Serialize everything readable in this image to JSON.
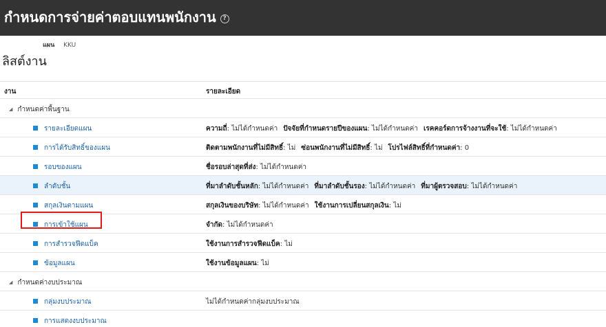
{
  "header": {
    "title": "กำหนดการจ่ายค่าตอบแทนพนักงาน",
    "help_icon": "help-circle-icon"
  },
  "plan": {
    "label": "แผน",
    "value": "KKU"
  },
  "page": {
    "heading": "ลิสต์งาน"
  },
  "table": {
    "col_task": "งาน",
    "col_detail": "รายละเอียด"
  },
  "rows": [
    {
      "type": "group",
      "label": "กำหนดค่าพื้นฐาน"
    },
    {
      "type": "task",
      "label": "รายละเอียดแผน",
      "details": [
        {
          "k": "ความถี่",
          "v": "ไม่ได้กำหนดค่า"
        },
        {
          "k": "ปัจจัยที่กำหนดรายปีของแผน",
          "v": "ไม่ได้กำหนดค่า"
        },
        {
          "k": "เรคคอร์ดการจ้างงานที่จะใช้",
          "v": "ไม่ได้กำหนดค่า"
        }
      ]
    },
    {
      "type": "task",
      "label": "การได้รับสิทธิ์ของแผน",
      "details": [
        {
          "k": "ติดตามพนักงานที่ไม่มีสิทธิ์",
          "v": "ไม่"
        },
        {
          "k": "ซ่อนพนักงานที่ไม่มีสิทธิ์",
          "v": "ไม่"
        },
        {
          "k": "โปรไฟล์สิทธิ์ที่กำหนดค่า",
          "v": "0"
        }
      ]
    },
    {
      "type": "task",
      "label": "รอบของแผน",
      "details": [
        {
          "k": "ชื่อรอบล่าสุดที่ส่ง",
          "v": "ไม่ได้กำหนดค่า"
        }
      ]
    },
    {
      "type": "task",
      "label": "ลำดับชั้น",
      "highlight": true,
      "details": [
        {
          "k": "ที่มาลำดับชั้นหลัก",
          "v": "ไม่ได้กำหนดค่า"
        },
        {
          "k": "ที่มาลำดับชั้นรอง",
          "v": "ไม่ได้กำหนดค่า"
        },
        {
          "k": "ที่มาผู้ตรวจสอบ",
          "v": "ไม่ได้กำหนดค่า"
        }
      ]
    },
    {
      "type": "task",
      "label": "สกุลเงินตามแผน",
      "details": [
        {
          "k": "สกุลเงินของบริษัท",
          "v": "ไม่ได้กำหนดค่า"
        },
        {
          "k": "ใช้งานการเปลี่ยนสกุลเงิน",
          "v": "ไม่"
        }
      ]
    },
    {
      "type": "task",
      "label": "การเข้าใช้แผน",
      "boxed": true,
      "details": [
        {
          "k": "จำกัด",
          "v": "ไม่ได้กำหนดค่า"
        }
      ]
    },
    {
      "type": "task",
      "label": "การสำรวจฟีดแบ็ค",
      "details": [
        {
          "k": "ใช้งานการสำรวจฟีดแบ็ค",
          "v": "ไม่"
        }
      ]
    },
    {
      "type": "task",
      "label": "ข้อมูลแผน",
      "details": [
        {
          "k": "ใช้งานข้อมูลแผน",
          "v": "ไม่"
        }
      ]
    },
    {
      "type": "group",
      "label": "กำหนดค่างบประมาณ"
    },
    {
      "type": "task",
      "label": "กลุ่มงบประมาณ",
      "plain": "ไม่ได้กำหนดค่ากลุ่มงบประมาณ"
    },
    {
      "type": "task",
      "label": "การแสดงงบประมาณ"
    }
  ],
  "colors": {
    "title_bar": "#333333",
    "link": "#1c62a8",
    "task_marker": "#1e8bcf",
    "highlight_row": "#eaf3fc",
    "annotation_box": "#e01818"
  }
}
